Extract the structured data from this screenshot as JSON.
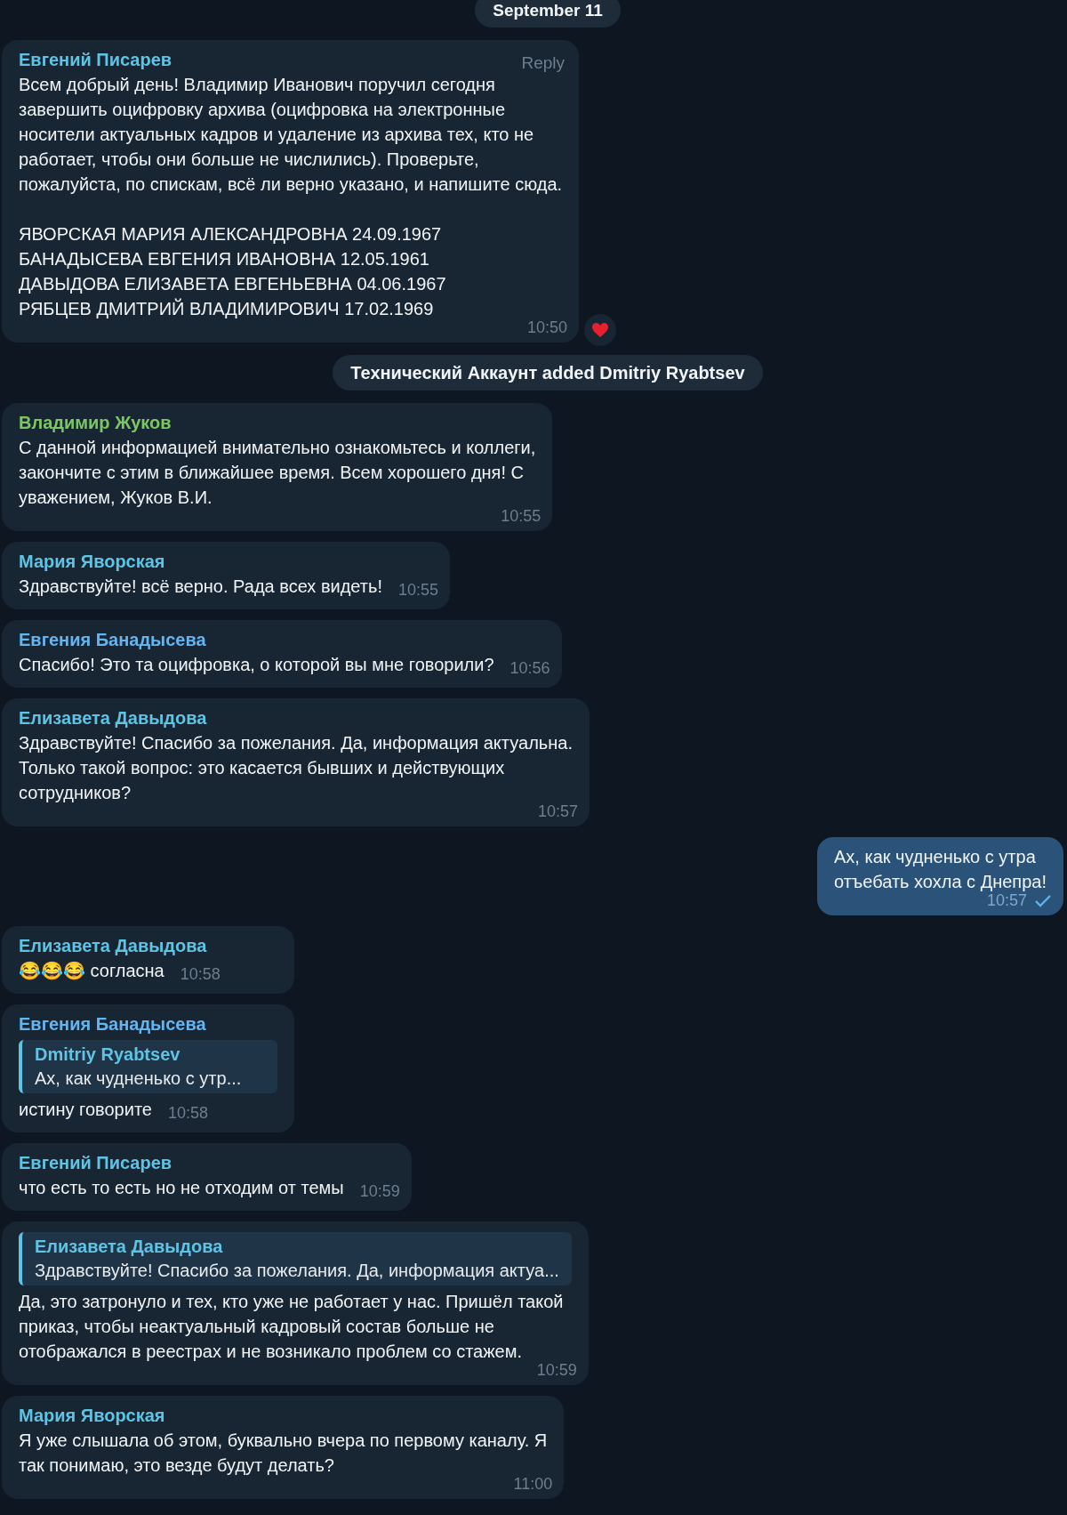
{
  "messages": [
    {
      "kind": "date",
      "text": "September 11"
    },
    {
      "kind": "incoming",
      "author": "Евгений Писарев",
      "color": "#5fc3e4",
      "hover_action": "Reply",
      "text": "Всем добрый день! Владимир Иванович поручил сегодня\nзавершить оцифровку архива (оцифровка на электронные\nносители актуальных кадров и удаление из архива тех, кто не\nработает, чтобы они больше не числились). Проверьте,\nпожалуйста, по спискам, всё ли верно указано, и напишите сюда.\n\nЯВОРСКАЯ МАРИЯ АЛЕКСАНДРОВНА 24.09.1967\nБАНАДЫСЕВА ЕВГЕНИЯ ИВАНОВНА 12.05.1961\nДАВЫДОВА ЕЛИЗАВЕТА ЕВГЕНЬЕВНА 04.06.1967\nРЯБЦЕВ ДМИТРИЙ ВЛАДИМИРОВИЧ 17.02.1969",
      "time": "10:50",
      "reacted": true
    },
    {
      "kind": "service",
      "text": "Технический Аккаунт added Dmitriy Ryabtsev"
    },
    {
      "kind": "incoming",
      "author": "Владимир Жуков",
      "color": "#7bc862",
      "text": "С данной информацией внимательно ознакомьтесь и коллеги,\nзакончите с этим в ближайшее время. Всем хорошего дня! С\nуважением, Жуков В.И.",
      "time": "10:55"
    },
    {
      "kind": "incoming",
      "author": "Мария Яворская",
      "color": "#5fc3e4",
      "text": "Здравствуйте! всё верно. Рада всех видеть!",
      "time": "10:55"
    },
    {
      "kind": "incoming",
      "author": "Евгения Банадысева",
      "color": "#64b5ef",
      "text": "Спасибо! Это та оцифровка, о которой вы мне говорили?",
      "time": "10:56"
    },
    {
      "kind": "incoming",
      "author": "Елизавета Давыдова",
      "color": "#5fc3e4",
      "text": "Здравствуйте! Спасибо за пожелания. Да, информация актуальна.\nТолько такой вопрос: это касается бывших и действующих\nсотрудников?",
      "time": "10:57"
    },
    {
      "kind": "outgoing",
      "text": "Ах, как чудненько с утра\nотъебать хохла с Днепра!",
      "time": "10:57",
      "read": false
    },
    {
      "kind": "incoming",
      "author": "Елизавета Давыдова",
      "color": "#5fc3e4",
      "text": "😂😂😂 согласна",
      "time": "10:58"
    },
    {
      "kind": "incoming",
      "author": "Евгения Банадысева",
      "color": "#64b5ef",
      "reply": {
        "author": "Dmitriy Ryabtsev",
        "text": "Ах, как чудненько с утр..."
      },
      "text": "истину говорите",
      "time": "10:58"
    },
    {
      "kind": "incoming",
      "author": "Евгений Писарев",
      "color": "#5fc3e4",
      "text": "что есть то есть но не отходим от темы",
      "time": "10:59"
    },
    {
      "kind": "incoming",
      "reply": {
        "author": "Елизавета Давыдова",
        "text": "Здравствуйте! Спасибо за пожелания. Да, информация актуа..."
      },
      "text": "Да, это затронуло и тех, кто уже не работает у нас. Пришёл такой\nприказ, чтобы неактуальный кадровый состав больше не\nотображался в реестрах и не возникало проблем со стажем.",
      "time": "10:59"
    },
    {
      "kind": "incoming",
      "author": "Мария Яворская",
      "color": "#5fc3e4",
      "text": "Я уже слышала об этом, буквально вчера по первому каналу. Я\nтак понимаю, это везде будут делать?",
      "time": "11:00"
    }
  ]
}
